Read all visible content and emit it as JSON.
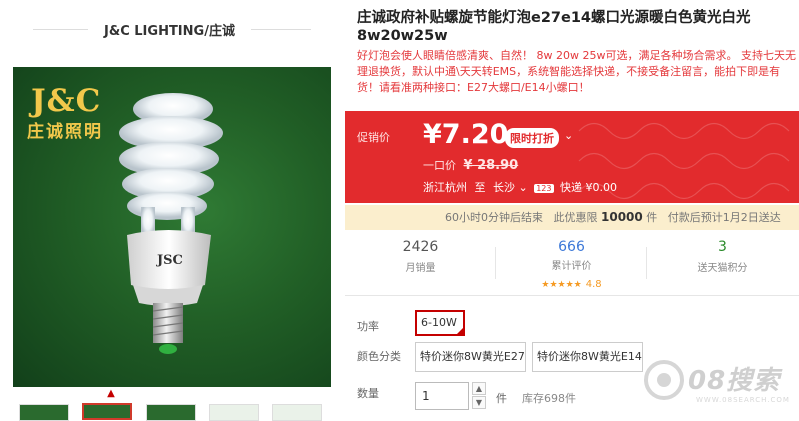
{
  "shop": {
    "name": "J&C LIGHTING/庄诚"
  },
  "gallery": {
    "brand_logo": "J&C",
    "brand_cn": "庄诚照明",
    "bulb_logo": "JSC",
    "thumbnails": 5,
    "active_thumbnail": 2
  },
  "product": {
    "title": "庄诚政府补贴螺旋节能灯泡e27e14螺口光源暖白色黄光白光8w20w25w",
    "description": "好灯泡会使人眼睛倍感清爽、自然！ 8w 20w 25w可选，满足各种场合需求。 支持七天无理退换货，默认中通\\天天转EMS，系统智能选择快递，不接受备注留言，能拍下即是有货！请看准两种接口：E27大螺口/E14小螺口！"
  },
  "price": {
    "promo_label": "促销价",
    "currency": "¥",
    "current": "7.20",
    "limit_tag": "限时打折",
    "original_label": "一口价",
    "original": "¥ 28.90"
  },
  "shipping": {
    "from": "浙江杭州",
    "to_label": "至",
    "to": "长沙",
    "badge": "123",
    "method": "快递 ¥0.00"
  },
  "countdown": {
    "remaining": "60小时0分钟",
    "ends_text": "后结束",
    "limit_prefix": "此优惠限",
    "limit_count": "10000",
    "limit_unit": "件",
    "delivery": "付款后预计1月2日送达"
  },
  "stats": [
    {
      "value": "2426",
      "label": "月销量"
    },
    {
      "value": "666",
      "label": "累计评价",
      "stars": "★★★★★",
      "score": "4.8"
    },
    {
      "value": "3",
      "label": "送天猫积分"
    }
  ],
  "options": {
    "power_label": "功率",
    "power_value": "6-10W",
    "color_label": "颜色分类",
    "color_values": [
      "特价迷你8W黄光E27",
      "特价迷你8W黄光E14"
    ],
    "qty_label": "数量",
    "qty_value": "1",
    "qty_unit": "件",
    "stock": "库存698件"
  },
  "watermark": {
    "text": "08搜索",
    "sub": "WWW.08SEARCH.COM"
  },
  "colors": {
    "accent": "#e22b2d",
    "countdown_bg": "#fbeecd",
    "selected_border": "#c40000"
  }
}
